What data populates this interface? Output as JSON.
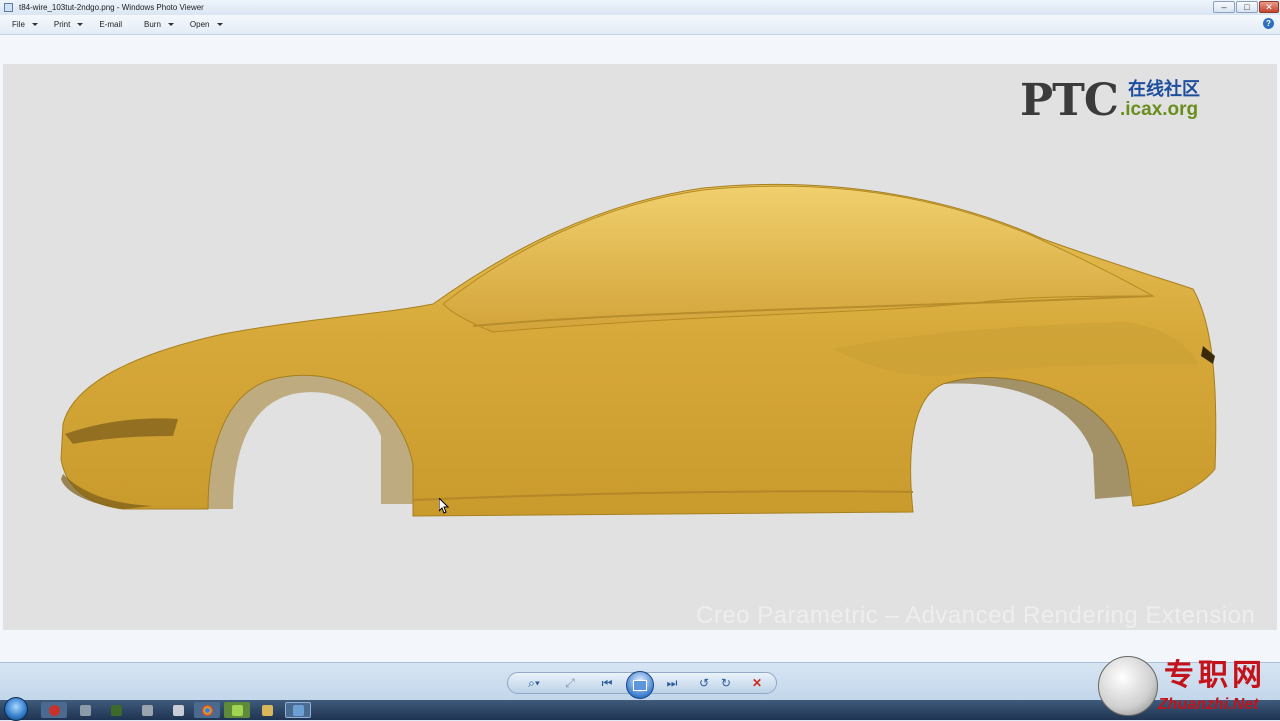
{
  "window": {
    "title": "t84-wire_103tut-2ndgo.png - Windows Photo Viewer",
    "controls": {
      "minimize": "–",
      "maximize": "□",
      "close": "✕"
    }
  },
  "menu": {
    "items": [
      {
        "label": "File"
      },
      {
        "label": "Print"
      },
      {
        "label": "E-mail"
      },
      {
        "label": "Burn"
      },
      {
        "label": "Open"
      }
    ],
    "help_label": "?"
  },
  "image": {
    "subject": "yellow car body surface model, side view",
    "body_color": "#d4a93c",
    "background_color": "#e1e1e1",
    "logo": {
      "brand": "PTC",
      "chinese": "在线社区",
      "site": ".icax.org"
    },
    "overlay_text": "Creo Parametric – Advanced Rendering Extension"
  },
  "controls": {
    "zoom": "⌕▾",
    "fit": "⤢",
    "previous": "⏮",
    "next": "⏭",
    "rotate_ccw": "↺",
    "rotate_cw": "↻",
    "delete": "✕"
  },
  "watermark": {
    "chinese": "专职网",
    "site": "Zhuanzhi.Net"
  },
  "taskbar": {
    "icons": [
      "app-red",
      "app-tools",
      "app-green-dark",
      "app-gray",
      "app-doc",
      "chrome",
      "app-green",
      "app-folder",
      "app-photo-viewer"
    ]
  }
}
